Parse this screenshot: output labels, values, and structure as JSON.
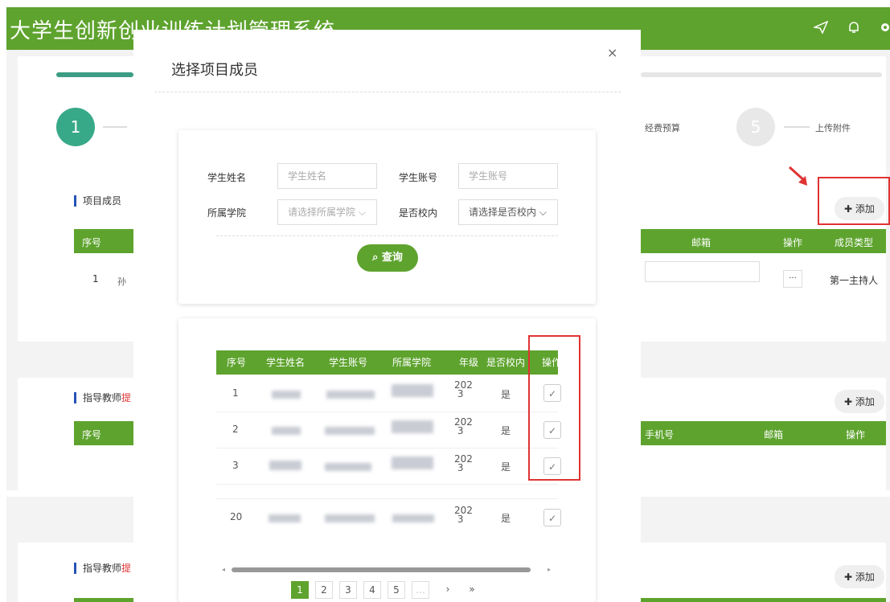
{
  "app": {
    "title": "大学生创新创业训练计划管理系统"
  },
  "topbar_icons": [
    "send-icon",
    "bell-icon",
    "gear-icon"
  ],
  "steps": {
    "first_number": "1",
    "budget_label": "经费预算",
    "fifth_number": "5",
    "upload_label": "上传附件"
  },
  "members_section": {
    "title": "项目成员",
    "add_label": "添加",
    "headers": {
      "seq": "序号",
      "email": "邮箱",
      "op": "操作",
      "type": "成员类型"
    },
    "row": {
      "seq": "1",
      "name_partial": "孙",
      "op_button": "···",
      "member_type": "第一主持人"
    }
  },
  "teachers_section": {
    "title": "指导教师",
    "title_suffix": "提",
    "add_label": "添加",
    "headers": {
      "seq": "序号",
      "phone": "手机号",
      "email": "邮箱",
      "op": "操作"
    }
  },
  "modal": {
    "title": "选择项目成员",
    "close": "×",
    "form": {
      "name_label": "学生姓名",
      "name_placeholder": "学生姓名",
      "account_label": "学生账号",
      "account_placeholder": "学生账号",
      "college_label": "所属学院",
      "college_placeholder": "请选择所属学院",
      "oncampus_label": "是否校内",
      "oncampus_placeholder": "请选择是否校内",
      "search_label": "查询"
    },
    "table": {
      "headers": {
        "seq": "序号",
        "name": "学生姓名",
        "account": "学生账号",
        "college": "所属学院",
        "grade": "年级",
        "oncampus": "是否校内",
        "op": "操作"
      },
      "rows": [
        {
          "seq": "1",
          "grade_top": "202",
          "grade_bottom": "3",
          "oncampus": "是",
          "check": "✓"
        },
        {
          "seq": "2",
          "grade_top": "202",
          "grade_bottom": "3",
          "oncampus": "是",
          "check": "✓"
        },
        {
          "seq": "3",
          "grade_top": "202",
          "grade_bottom": "3",
          "oncampus": "是",
          "check": "✓"
        },
        {
          "seq": "20",
          "grade_top": "202",
          "grade_bottom": "3",
          "oncampus": "是",
          "check": "✓"
        }
      ]
    },
    "pagination": {
      "pages": [
        "1",
        "2",
        "3",
        "4",
        "5"
      ],
      "next": "›",
      "last": "»",
      "current": "1"
    },
    "scroll": {
      "left": "◂",
      "right": "▸"
    }
  },
  "colors": {
    "brand_green": "#5ea32e",
    "highlight_red": "#e03333",
    "section_blue": "#2553b5",
    "step_teal": "#38a988"
  }
}
